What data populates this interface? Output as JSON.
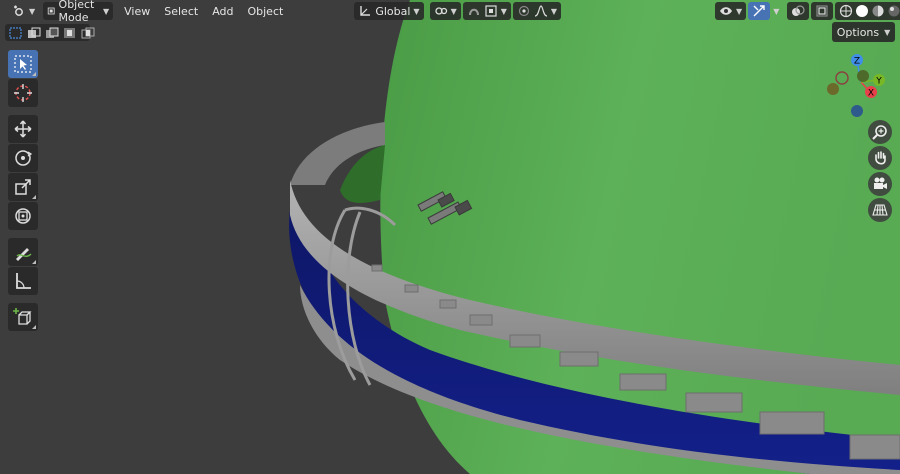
{
  "header": {
    "mode_label": "Object Mode",
    "menus": [
      "View",
      "Select",
      "Add",
      "Object"
    ],
    "orientation_label": "Global"
  },
  "options_label": "Options",
  "gizmo": {
    "x_label": "X",
    "y_label": "Y",
    "z_label": "Z"
  },
  "colors": {
    "viewport_bg": "#3d3d3d",
    "sphere_green": "#5aaa55",
    "ring_blue": "#0f1a78",
    "ring_gray": "#9a9a9a",
    "active_tool": "#4772b3",
    "axis_x": "#e8404a",
    "axis_y": "#78b826",
    "axis_z": "#3f8ee8"
  },
  "toolbar": [
    "select-box",
    "cursor",
    "move",
    "rotate",
    "scale",
    "transform",
    "annotate",
    "measure",
    "add-cube"
  ],
  "nav": [
    "zoom",
    "pan",
    "camera",
    "ortho-grid"
  ]
}
